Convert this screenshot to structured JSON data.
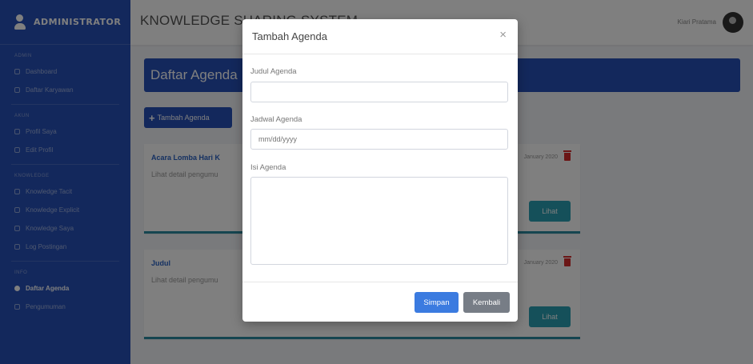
{
  "sidebar": {
    "brand": "ADMINISTRATOR",
    "groups": [
      {
        "heading": "Admin",
        "items": [
          "Dashboard",
          "Daftar Karyawan"
        ]
      },
      {
        "heading": "Akun",
        "items": [
          "Profil Saya",
          "Edit Profil"
        ]
      },
      {
        "heading": "Knowledge",
        "items": [
          "Knowledge Tacit",
          "Knowledge Explicit",
          "Knowledge Saya",
          "Log Postingan"
        ]
      },
      {
        "heading": "Info",
        "items": [
          "Daftar Agenda",
          "Pengumuman"
        ]
      }
    ],
    "active_item": "Daftar Agenda"
  },
  "topbar": {
    "title": "KNOWLEDGE SHARING SYSTEM",
    "user_name": "Kiari Pratama"
  },
  "page": {
    "heading": "Daftar Agenda",
    "add_button": "Tambah Agenda",
    "cards": [
      {
        "title": "Acara Lomba Hari K",
        "description": "Lihat detail pengumu",
        "date": "January 2020",
        "button": "Lihat"
      },
      {
        "title": "Judul",
        "description": "Lihat detail pengumu",
        "date": "January 2020",
        "button": "Lihat"
      }
    ]
  },
  "modal": {
    "title": "Tambah Agenda",
    "close_glyph": "×",
    "fields": {
      "judul": {
        "label": "Judul Agenda",
        "value": ""
      },
      "jadwal": {
        "label": "Jadwal Agenda",
        "placeholder": "mm/dd/yyyy"
      },
      "isi": {
        "label": "Isi Agenda",
        "value": ""
      }
    },
    "save_button": "Simpan",
    "back_button": "Kembali"
  },
  "colors": {
    "primary": "#2750b8",
    "card_accent": "#2a8ba0",
    "danger": "#d62c2c",
    "save": "#3b7be0",
    "secondary": "#777d86"
  }
}
